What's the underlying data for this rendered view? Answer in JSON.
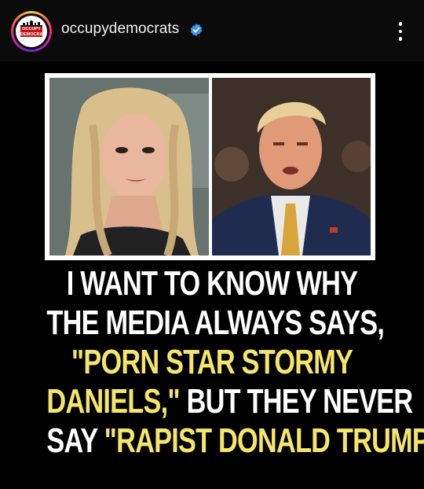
{
  "header": {
    "username": "occupydemocrats",
    "verified_icon": "verified-badge-icon",
    "menu_icon": "more-vertical-icon",
    "avatar": {
      "logo_text": "OCCUPY DEMOCRATS"
    }
  },
  "post": {
    "headline": {
      "line1": "I WANT TO KNOW WHY",
      "line2": "THE MEDIA ALWAYS SAYS,",
      "line3": "\"PORN STAR STORMY",
      "line4_yellow": "DANIELS,\"",
      "line4_white": " BUT THEY NEVER",
      "line5_white": "SAY ",
      "line5_yellow": "\"RAPIST DONALD TRUMP.\""
    }
  },
  "colors": {
    "accent_yellow": "#f5e66a",
    "verified_blue": "#3897f0",
    "background": "#000000"
  }
}
